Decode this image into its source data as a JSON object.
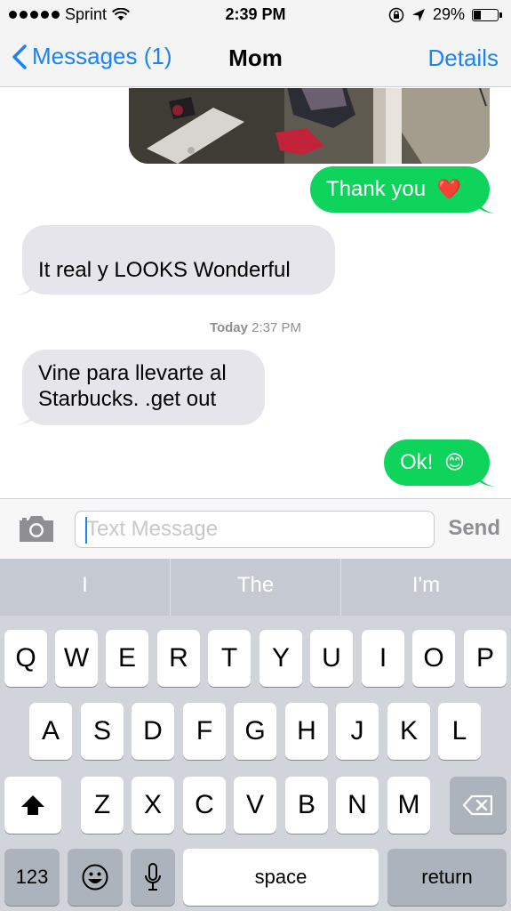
{
  "status_bar": {
    "carrier": "Sprint",
    "time": "2:39 PM",
    "battery": "29%",
    "battery_level": 0.29,
    "icons": [
      "signal-dots-icon",
      "wifi-icon",
      "orientation-lock-icon",
      "location-arrow-icon",
      "battery-icon"
    ]
  },
  "nav": {
    "back_label": "Messages (1)",
    "title": "Mom",
    "details_label": "Details"
  },
  "messages": [
    {
      "direction": "out",
      "text": "Thank you",
      "emoji": "❤️"
    },
    {
      "direction": "in",
      "text": "It real y LOOKS Wonderful"
    },
    {
      "direction": "in",
      "lines": [
        "Vine para llevarte al",
        "Starbucks. .get out"
      ]
    },
    {
      "direction": "out",
      "text": "Ok!",
      "emoji": "😊"
    }
  ],
  "timestamp": {
    "day": "Today",
    "time": "2:37 PM"
  },
  "input": {
    "placeholder": "Text Message",
    "send_label": "Send"
  },
  "predictions": [
    "I",
    "The",
    "I'm"
  ],
  "keyboard": {
    "row1": [
      "Q",
      "W",
      "E",
      "R",
      "T",
      "Y",
      "U",
      "I",
      "O",
      "P"
    ],
    "row2": [
      "A",
      "S",
      "D",
      "F",
      "G",
      "H",
      "J",
      "K",
      "L"
    ],
    "row3": [
      "Z",
      "X",
      "C",
      "V",
      "B",
      "N",
      "M"
    ],
    "numbers_label": "123",
    "space_label": "space",
    "return_label": "return"
  },
  "colors": {
    "ios_blue": "#1a82fb",
    "outgoing_bubble": "#0fd45c",
    "incoming_bubble": "#e6e5eb",
    "keyboard_bg": "#d1d5db"
  }
}
